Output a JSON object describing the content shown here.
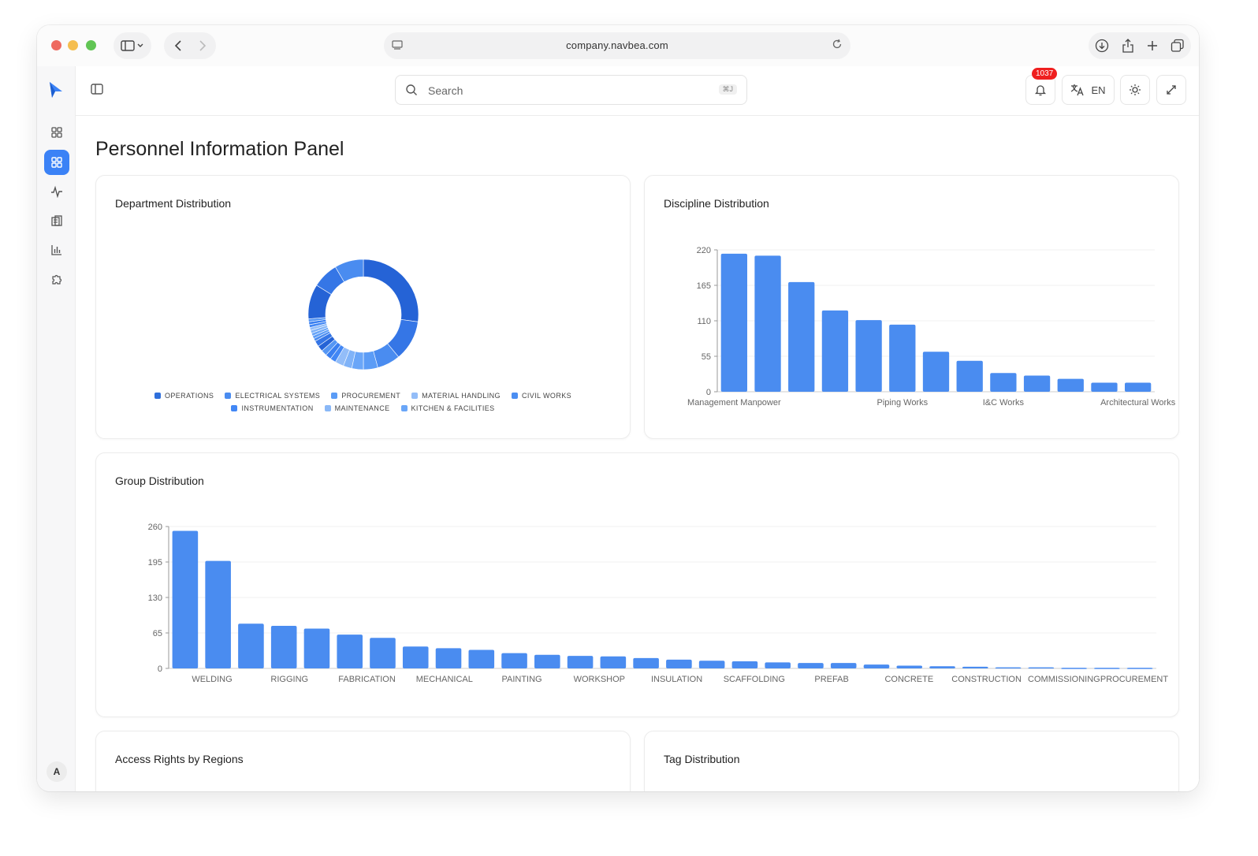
{
  "browser": {
    "url": "company.navbea.com"
  },
  "topbar": {
    "search_placeholder": "Search",
    "search_shortcut": "⌘J",
    "notification_count": "1037",
    "language": "EN"
  },
  "sidebar": {
    "items": [
      {
        "icon": "grid-icon",
        "active": false
      },
      {
        "icon": "dashboard-icon",
        "active": true
      },
      {
        "icon": "activity-icon",
        "active": false
      },
      {
        "icon": "building-icon",
        "active": false
      },
      {
        "icon": "bar-chart-icon",
        "active": false
      },
      {
        "icon": "puzzle-icon",
        "active": false
      }
    ],
    "avatar_initial": "A"
  },
  "page": {
    "title": "Personnel Information Panel"
  },
  "cards": {
    "department": "Department Distribution",
    "discipline": "Discipline Distribution",
    "group": "Group Distribution",
    "access": "Access Rights by Regions",
    "tag": "Tag Distribution"
  },
  "colors": {
    "accent": "#3b82f6",
    "bar": "#5b9cf6",
    "badge": "#ef1f1f"
  },
  "chart_data": [
    {
      "type": "pie",
      "variant": "donut",
      "legend": [
        "OPERATIONS",
        "ELECTRICAL SYSTEMS",
        "PROCUREMENT",
        "MATERIAL HANDLING",
        "CIVIL WORKS",
        "INSTRUMENTATION",
        "MAINTENANCE",
        "KITCHEN & FACILITIES"
      ],
      "legend_colors": [
        "#2f6fdb",
        "#4a8cf0",
        "#5b9cf6",
        "#93bdf8",
        "#4b8ef2",
        "#4287f5",
        "#8ab8f7",
        "#6aa6f8"
      ],
      "values": [
        32,
        14,
        8,
        5,
        4,
        3,
        3,
        2,
        2,
        2,
        2,
        2,
        1,
        1,
        1,
        1,
        1,
        1,
        1,
        1,
        12,
        9,
        10
      ]
    },
    {
      "type": "bar",
      "categories": [
        "Management Manpower",
        "",
        "",
        "",
        "",
        "Piping Works",
        "",
        "",
        "I&C Works",
        "",
        "",
        "",
        "Architectural Works"
      ],
      "values": [
        214,
        211,
        170,
        126,
        111,
        104,
        62,
        48,
        29,
        25,
        20,
        14,
        14
      ],
      "yticks": [
        0,
        55,
        110,
        165,
        220
      ],
      "ylim": [
        0,
        220
      ]
    },
    {
      "type": "bar",
      "categories": [
        "WELDING",
        "",
        "RIGGING",
        "",
        "FABRICATION",
        "",
        "MECHANICAL",
        "",
        "PAINTING",
        "",
        "WORKSHOP",
        "",
        "INSULATION",
        "",
        "SCAFFOLDING",
        "",
        "PREFAB",
        "",
        "CONCRETE",
        "",
        "CONSTRUCTION",
        "",
        "COMMISSIONING",
        "",
        "PROCUREMENT",
        ""
      ],
      "values": [
        252,
        197,
        82,
        78,
        73,
        62,
        56,
        40,
        37,
        34,
        28,
        25,
        23,
        22,
        19,
        16,
        14,
        13,
        11,
        10,
        10,
        7,
        5,
        4,
        3,
        2,
        2,
        1,
        1,
        1
      ],
      "yticks": [
        0,
        65,
        130,
        195,
        260
      ],
      "ylim": [
        0,
        260
      ]
    }
  ]
}
